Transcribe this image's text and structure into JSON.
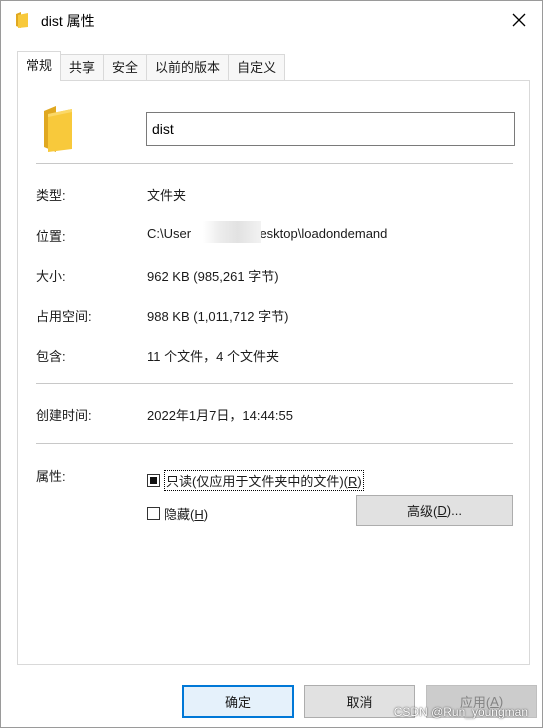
{
  "window": {
    "title": "dist 属性",
    "close_glyph": "✕"
  },
  "tabs": [
    {
      "label": "常规",
      "active": true
    },
    {
      "label": "共享",
      "active": false
    },
    {
      "label": "安全",
      "active": false
    },
    {
      "label": "以前的版本",
      "active": false
    },
    {
      "label": "自定义",
      "active": false
    }
  ],
  "general": {
    "folder_name": "dist",
    "icon": "folder-icon",
    "type_label": "类型:",
    "type_value": "文件夹",
    "location_label": "位置:",
    "location_value_start": "C:\\User",
    "location_value_end": "Desktop\\loadondemand",
    "size_label": "大小:",
    "size_value": "962 KB (985,261 字节)",
    "disk_size_label": "占用空间:",
    "disk_size_value": "988 KB (1,011,712 字节)",
    "contains_label": "包含:",
    "contains_value": "11 个文件，4 个文件夹",
    "created_label": "创建时间:",
    "created_value": "2022年1月7日，14:44:55",
    "attributes_label": "属性:",
    "readonly_text": "只读(仅应用于文件夹中的文件)(",
    "readonly_key": "R",
    "readonly_state": "indeterminate",
    "hidden_text": "隐藏(",
    "hidden_key": "H",
    "hidden_state": "unchecked",
    "advanced_text": "高级(",
    "advanced_key": "D",
    "advanced_suffix": ")..."
  },
  "buttons": {
    "ok": "确定",
    "cancel": "取消",
    "apply_text": "应用(",
    "apply_key": "A",
    "apply_enabled": false
  },
  "watermark": "CSDN @Run_youngman",
  "colors": {
    "accent": "#0078d7",
    "folder": "#f8c93b",
    "folder_dark": "#e0a820"
  }
}
